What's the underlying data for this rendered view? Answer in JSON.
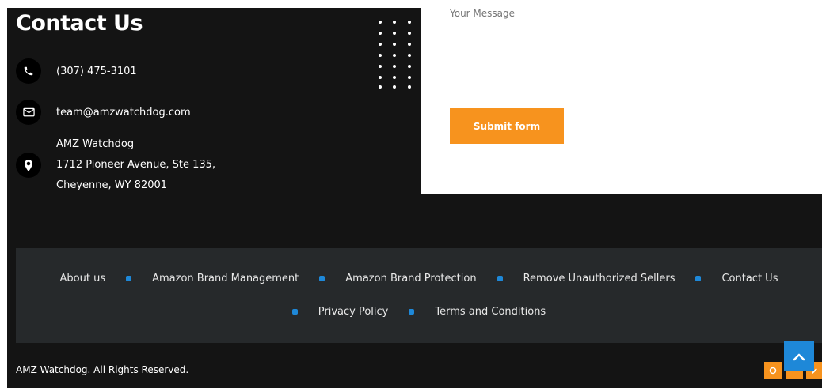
{
  "contact": {
    "title": "Contact Us",
    "phone": "(307) 475-3101",
    "email": "team@amzwatchdog.com",
    "address_line1": "AMZ Watchdog",
    "address_line2": "1712 Pioneer Avenue, Ste 135,",
    "address_line3": "Cheyenne, WY 82001"
  },
  "form": {
    "message_placeholder": "Your Message",
    "submit_label": "Submit form"
  },
  "footer_nav": {
    "row1": [
      "About us",
      "Amazon Brand Management",
      "Amazon Brand Protection",
      "Remove Unauthorized Sellers",
      "Contact Us"
    ],
    "row2": [
      "Privacy Policy",
      "Terms and Conditions"
    ]
  },
  "footer": {
    "copyright": "AMZ Watchdog. All Rights Reserved."
  },
  "colors": {
    "accent_orange": "#f7931e",
    "accent_blue": "#1e88d8",
    "dark_bg": "#141414",
    "nav_band_bg": "#26292b"
  },
  "icons": {
    "phone": "phone-icon",
    "email": "envelope-icon",
    "location": "map-pin-icon",
    "scroll_top": "chevron-up-icon",
    "social": [
      "social-icon-1",
      "social-icon-2",
      "social-icon-3"
    ]
  }
}
